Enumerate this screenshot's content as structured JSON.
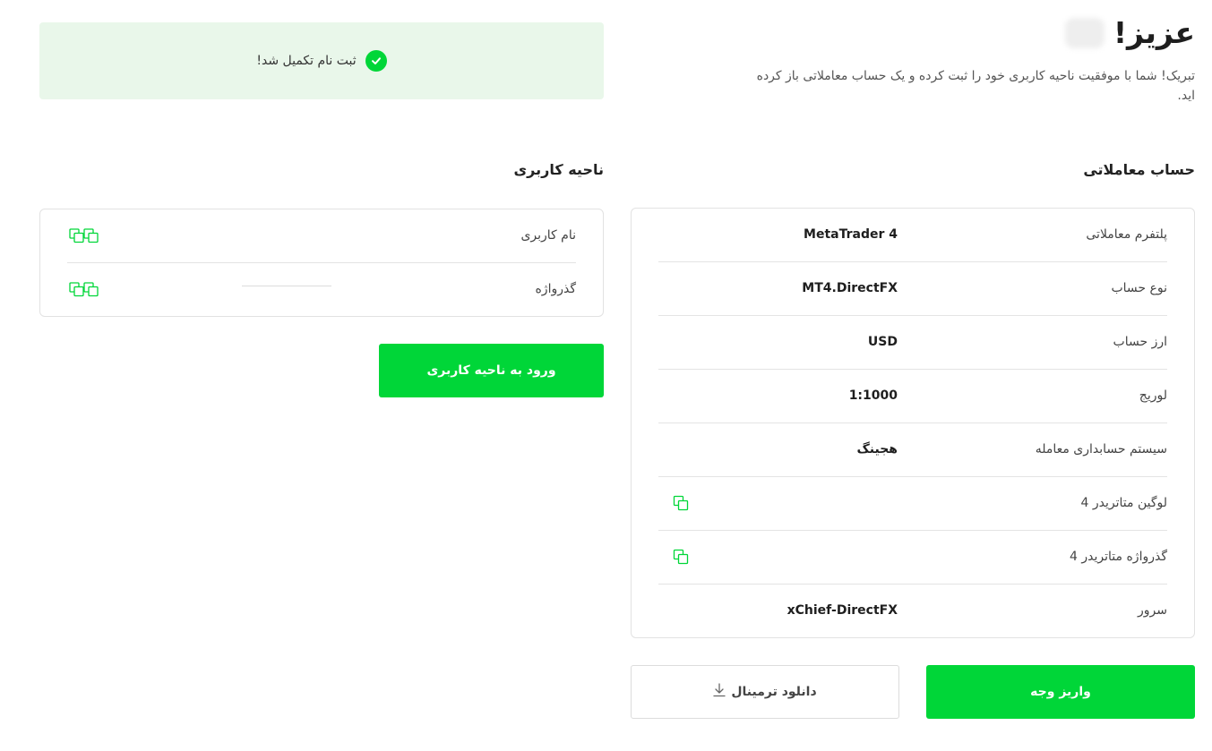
{
  "header": {
    "greeting": "عزیز!",
    "congrats": "تبریک! شما با موفقیت ناحیه کاربری خود را ثبت کرده و یک حساب معاملاتی باز کرده اید."
  },
  "banner": {
    "text": "ثبت نام تکمیل شد!"
  },
  "account": {
    "title": "حساب معاملاتی",
    "rows": [
      {
        "label": "پلتفرم معاملاتی",
        "value": "MetaTrader 4"
      },
      {
        "label": "نوع حساب",
        "value": "MT4.DirectFX"
      },
      {
        "label": "ارز حساب",
        "value": "USD"
      },
      {
        "label": "لوریج",
        "value": "1:1000"
      },
      {
        "label": "سیستم حسابداری معامله",
        "value": "هجینگ"
      },
      {
        "label": "لوگین متاتریدر 4",
        "value": ""
      },
      {
        "label": "گذرواژه متاتریدر 4",
        "value": ""
      },
      {
        "label": "سرور",
        "value": "xChief-DirectFX"
      }
    ]
  },
  "user_area": {
    "title": "ناحیه کاربری",
    "rows": [
      {
        "label": "نام کاربری"
      },
      {
        "label": "گذرواژه"
      }
    ]
  },
  "buttons": {
    "login": "ورود به ناحیه کاربری",
    "deposit": "واریز وجه",
    "download": "دانلود ترمینال"
  },
  "icons": {
    "check": "check-circle-icon",
    "copy": "copy-icon",
    "download": "download-icon"
  },
  "colors": {
    "accent": "#00d638",
    "banner_bg": "#e9f7ea",
    "border": "#e2e2e2"
  }
}
